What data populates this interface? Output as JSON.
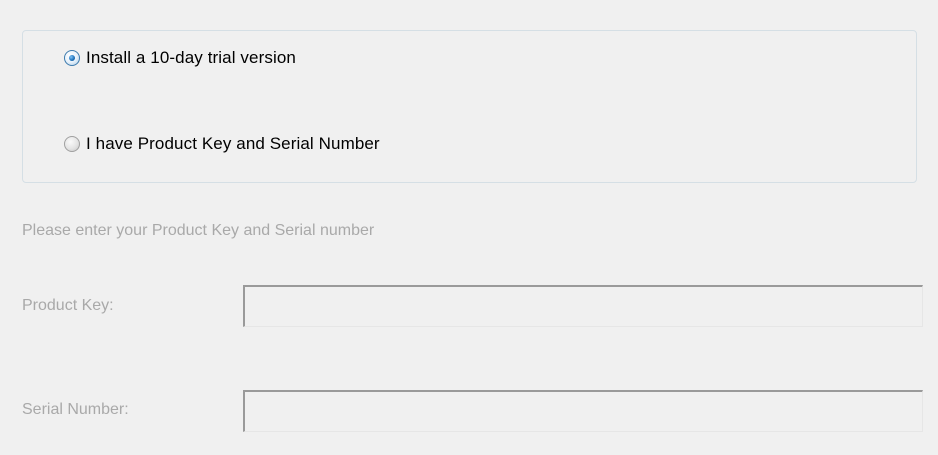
{
  "install_options": {
    "trial": {
      "label": "Install a 10-day trial version",
      "selected": true
    },
    "licensed": {
      "label": "I have Product Key and Serial Number",
      "selected": false
    }
  },
  "license_form": {
    "instruction": "Please enter your Product Key and Serial number",
    "product_key": {
      "label": "Product Key:",
      "value": "",
      "enabled": false
    },
    "serial_number": {
      "label": "Serial Number:",
      "value": "",
      "enabled": false
    }
  },
  "colors": {
    "background": "#f0f0f0",
    "disabled_text": "#a9a9a9",
    "radio_selected": "#1b6fb8"
  }
}
